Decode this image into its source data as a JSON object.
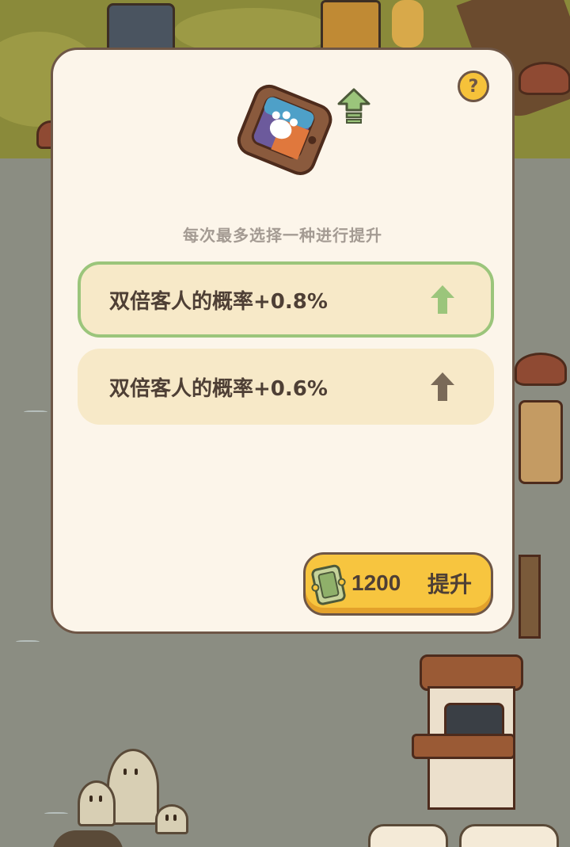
{
  "dialog": {
    "hint": "每次最多选择一种进行提升",
    "help_icon": "?",
    "item_icon": "arcade-tablet-icon",
    "options": [
      {
        "label": "双倍客人的概率+0.8%",
        "selected": true,
        "arrow_color": "#9bc57b"
      },
      {
        "label": "双倍客人的概率+0.6%",
        "selected": false,
        "arrow_color": "#7a6a58"
      }
    ],
    "upgrade_button": {
      "cost": "1200",
      "label": "提升",
      "currency_icon": "ticket-icon"
    }
  },
  "colors": {
    "panel_bg": "#fcf5ea",
    "option_bg": "#f7e9c8",
    "selected_border": "#9bc57b",
    "button_yellow": "#f7c53f",
    "text_dark": "#4e3f35",
    "hint_gray": "#a49b93"
  }
}
